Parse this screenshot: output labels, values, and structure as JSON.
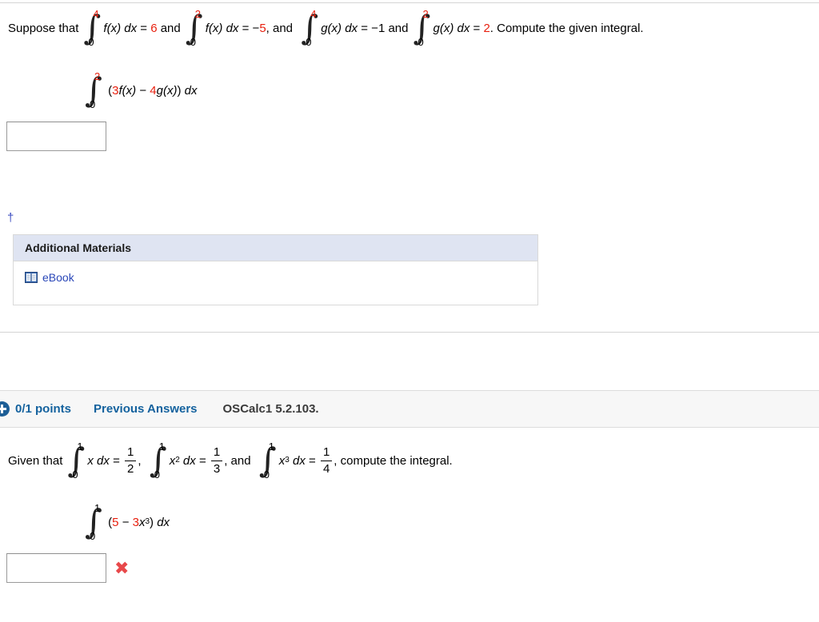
{
  "page": {
    "background": "#ffffff",
    "accent_blue": "#14629e",
    "link_blue": "#2a47b8",
    "red": "#e8200f",
    "wrong_red": "#e8484a"
  },
  "problem1": {
    "prompt_prefix": "Suppose that",
    "givens": [
      {
        "integral": {
          "upper": "4",
          "lower": "0",
          "upper_red": true
        },
        "integrand": "f(x)",
        "differential": "dx",
        "equals": "=",
        "value": "6",
        "value_red": true,
        "trailing": "and"
      },
      {
        "integral": {
          "upper": "2",
          "lower": "0",
          "upper_red": true
        },
        "integrand": "f(x)",
        "differential": "dx",
        "equals": "=",
        "sign": "−",
        "value": "5",
        "value_red": true,
        "trailing": ", and"
      },
      {
        "integral": {
          "upper": "4",
          "lower": "0",
          "upper_red": true
        },
        "integrand": "g(x)",
        "differential": "dx",
        "equals": "=",
        "sign": "−",
        "value": "1",
        "value_red": false,
        "trailing": "and"
      },
      {
        "integral": {
          "upper": "2",
          "lower": "0",
          "upper_red": true
        },
        "integrand": "g(x)",
        "differential": "dx",
        "equals": "=",
        "value": "2",
        "value_red": true,
        "trailing": ". Compute the given integral."
      }
    ],
    "target": {
      "integral": {
        "upper": "2",
        "lower": "0",
        "upper_red": true
      },
      "open_paren": "(",
      "coef1": "3",
      "term1": "f(x)",
      "operator": "−",
      "coef2": "4",
      "term2": "g(x)",
      "close_paren": ")",
      "differential": "dx"
    },
    "answer_value": "",
    "answer_placeholder": "",
    "footnote_marker": "†",
    "additional_materials": {
      "header": "Additional Materials",
      "links": [
        {
          "icon": "book-icon",
          "label": "eBook"
        }
      ]
    }
  },
  "problem2": {
    "header": {
      "plus_icon": "plus-circle-icon",
      "points": "0/1 points",
      "previous_answers": "Previous Answers",
      "question_tag": "OSCalc1 5.2.103."
    },
    "prompt_prefix": "Given that",
    "givens": [
      {
        "integral": {
          "upper": "1",
          "lower": "0"
        },
        "integrand": "x",
        "differential": "dx",
        "equals": "=",
        "fraction": {
          "numerator": "1",
          "denominator": "2"
        },
        "trailing": ","
      },
      {
        "integral": {
          "upper": "1",
          "lower": "0"
        },
        "integrand": "x",
        "exponent": "2",
        "differential": "dx",
        "equals": "=",
        "fraction": {
          "numerator": "1",
          "denominator": "3"
        },
        "trailing": ", and"
      },
      {
        "integral": {
          "upper": "1",
          "lower": "0"
        },
        "integrand": "x",
        "exponent": "3",
        "differential": "dx",
        "equals": "=",
        "fraction": {
          "numerator": "1",
          "denominator": "4"
        },
        "trailing": ", compute the integral."
      }
    ],
    "target": {
      "integral": {
        "upper": "1",
        "lower": "0"
      },
      "open_paren": "(",
      "coef1": "5",
      "operator": "−",
      "coef2": "3",
      "term2": "x",
      "exponent2": "3",
      "close_paren": ")",
      "differential": "dx"
    },
    "answer_value": "",
    "answer_placeholder": "",
    "result_mark": "✖"
  }
}
